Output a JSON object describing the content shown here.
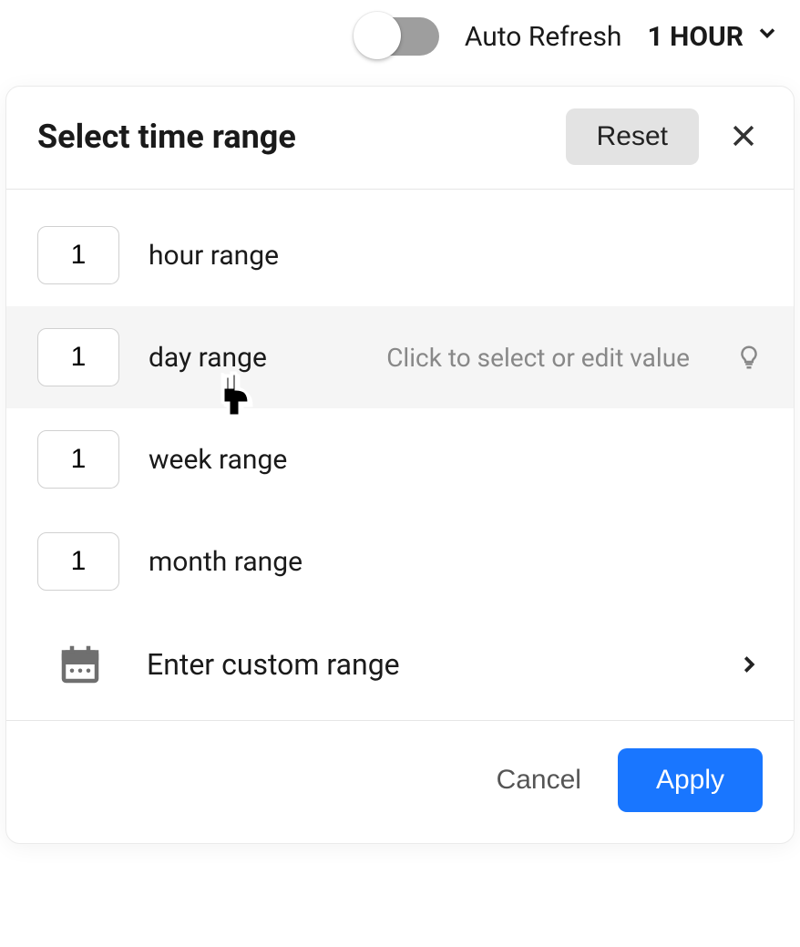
{
  "topbar": {
    "auto_refresh_label": "Auto Refresh",
    "auto_refresh_on": false,
    "time_pill_label": "1 HOUR"
  },
  "dialog": {
    "title": "Select time range",
    "reset_label": "Reset",
    "hint_text": "Click to select or edit value",
    "ranges": [
      {
        "value": "1",
        "label": "hour range",
        "hovered": false
      },
      {
        "value": "1",
        "label": "day range",
        "hovered": true
      },
      {
        "value": "1",
        "label": "week range",
        "hovered": false
      },
      {
        "value": "1",
        "label": "month range",
        "hovered": false
      }
    ],
    "custom_label": "Enter custom range",
    "cancel_label": "Cancel",
    "apply_label": "Apply"
  }
}
